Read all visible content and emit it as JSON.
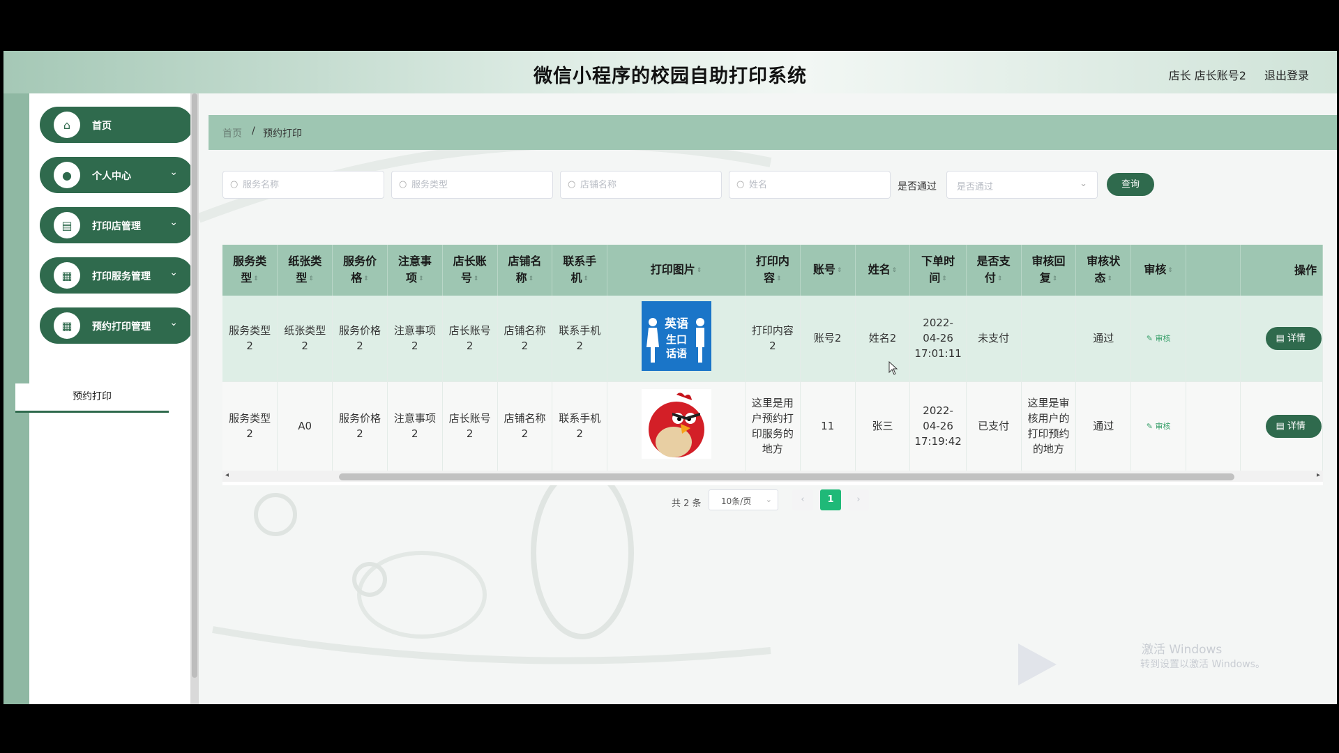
{
  "header": {
    "title": "微信小程序的校园自助打印系统",
    "user": "店长 店长账号2",
    "logout": "退出登录"
  },
  "sidebar": {
    "items": [
      {
        "label": "首页",
        "icon": "home-icon"
      },
      {
        "label": "个人中心",
        "icon": "user-icon"
      },
      {
        "label": "打印店管理",
        "icon": "clipboard-icon"
      },
      {
        "label": "打印服务管理",
        "icon": "grid-icon"
      },
      {
        "label": "预约打印管理",
        "icon": "grid-icon"
      }
    ],
    "submenu": "预约打印"
  },
  "breadcrumb": {
    "home": "首页",
    "separator": "/",
    "current": "预约打印"
  },
  "search": {
    "service_name": "服务名称",
    "service_type": "服务类型",
    "shop_name": "店铺名称",
    "name": "姓名",
    "pass_label": "是否通过",
    "pass_placeholder": "是否通过",
    "query": "查询"
  },
  "table": {
    "headers": [
      "服务类型",
      "纸张类型",
      "服务价格",
      "注意事项",
      "店长账号",
      "店铺名称",
      "联系手机",
      "打印图片",
      "打印内容",
      "账号",
      "姓名",
      "下单时间",
      "是否支付",
      "审核回复",
      "审核状态",
      "审核",
      "",
      "操作"
    ],
    "rows": [
      {
        "service_type": "服务类型2",
        "paper_type": "纸张类型2",
        "price": "服务价格2",
        "notes": "注意事项2",
        "manager": "店长账号2",
        "shop": "店铺名称2",
        "phone": "联系手机2",
        "image": "英语生口话语",
        "content": "打印内容2",
        "account": "账号2",
        "name": "姓名2",
        "time": "2022-04-26 17:01:11",
        "paid": "未支付",
        "reply": "",
        "status": "通过",
        "audit": "审核",
        "action": "详情"
      },
      {
        "service_type": "服务类型2",
        "paper_type": "A0",
        "price": "服务价格2",
        "notes": "注意事项2",
        "manager": "店长账号2",
        "shop": "店铺名称2",
        "phone": "联系手机2",
        "image": "",
        "content": "这里是用户预约打印服务的地方",
        "account": "11",
        "name": "张三",
        "time": "2022-04-26 17:19:42",
        "paid": "已支付",
        "reply": "这里是审核用户的打印预约的地方",
        "status": "通过",
        "audit": "审核",
        "action": "详情"
      }
    ]
  },
  "pagination": {
    "total": "共 2 条",
    "page_size": "10条/页",
    "current": "1",
    "prev": "‹",
    "next": "›"
  },
  "watermark": {
    "line1": "激活 Windows",
    "line2": "转到设置以激活 Windows。"
  },
  "colors": {
    "primary": "#2f6a4d",
    "header_bg": "#9ec6b2",
    "active_page": "#1fb978"
  }
}
